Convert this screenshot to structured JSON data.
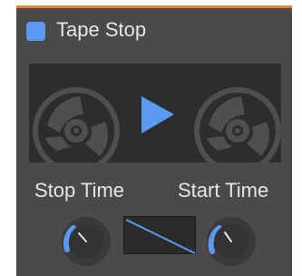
{
  "plugin": {
    "title": "Tape Stop",
    "enabled": true,
    "accent_color": "#5b9af0",
    "header_color": "#e8832b"
  },
  "controls": {
    "stop_time": {
      "label": "Stop Time",
      "value_fraction": 0.45
    },
    "start_time": {
      "label": "Start Time",
      "value_fraction": 0.4
    }
  },
  "icons": {
    "play": "play-icon",
    "reel_left": "tape-reel-icon",
    "reel_right": "tape-reel-icon"
  }
}
